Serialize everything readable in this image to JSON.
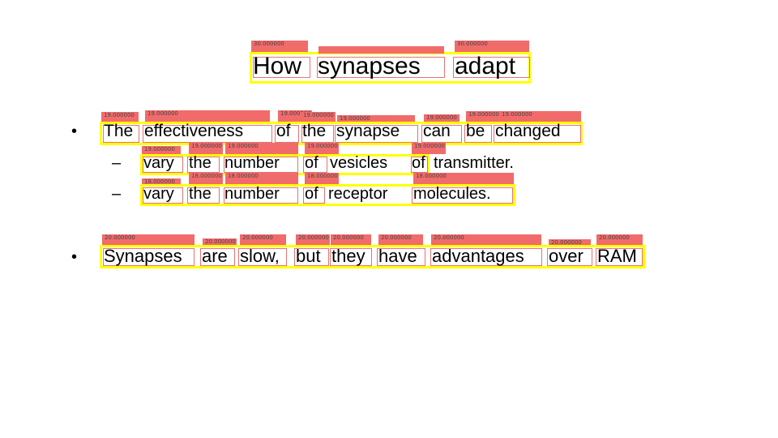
{
  "title": {
    "words": [
      "How",
      "synapses",
      "adapt"
    ],
    "sizes": [
      "30.000000",
      "30.000000",
      "30.000000"
    ]
  },
  "bullet_glyph": "•",
  "dash_glyph": "–",
  "line1": {
    "words": [
      "The",
      "effectiveness",
      "of",
      "the",
      "synapse",
      "can",
      "be",
      "changed"
    ],
    "sizes": [
      "19.000000",
      "19.000000",
      "19.000000",
      "19.000000",
      "19.000000",
      "19.000000",
      "19.000000",
      "19.000000"
    ]
  },
  "line2": {
    "words": [
      "vary",
      "the",
      "number",
      "of",
      "vesicles",
      "of",
      "transmitter."
    ],
    "sizes": [
      "19.000000",
      "19.000000",
      "19.000000",
      "19.000000",
      "19.000000"
    ]
  },
  "line3": {
    "words": [
      "vary",
      "the",
      "number",
      "of",
      "receptor",
      "molecules."
    ],
    "sizes": [
      "18.000000",
      "18.000000",
      "18.000000",
      "18.000000",
      "18.000000"
    ]
  },
  "line4": {
    "words": [
      "Synapses",
      "are",
      "slow,",
      "but",
      "they",
      "have",
      "advantages",
      "over",
      "RAM"
    ],
    "sizes": [
      "20.000000",
      "20.000000",
      "20.000000",
      "20.000000",
      "20.000000",
      "20.000000",
      "20.000000",
      "20.000000",
      "20.000000"
    ]
  }
}
